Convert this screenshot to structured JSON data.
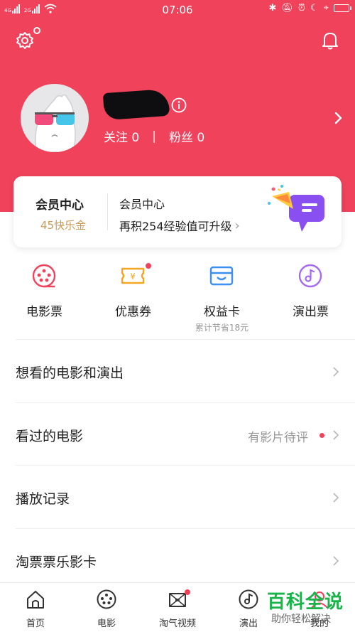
{
  "status_bar": {
    "signal_1": "4G",
    "signal_2": "2G",
    "time": "07:06"
  },
  "header": {
    "settings_icon": "gear-icon",
    "bell_icon": "bell-icon",
    "follow_label": "关注",
    "follow_count": "0",
    "separator": "|",
    "fans_label": "粉丝",
    "fans_count": "0",
    "brand_color": "#f1425c"
  },
  "member_card": {
    "title": "会员中心",
    "points": "45快乐金",
    "sub_title": "会员中心",
    "upgrade_text": "再积254经验值可升级",
    "arrow": "›"
  },
  "quick_links": [
    {
      "label": "电影票",
      "sub": "",
      "icon": "film-reel-icon"
    },
    {
      "label": "优惠券",
      "sub": "",
      "icon": "coupon-icon"
    },
    {
      "label": "权益卡",
      "sub": "累计节省18元",
      "icon": "card-icon"
    },
    {
      "label": "演出票",
      "sub": "",
      "icon": "music-note-icon"
    }
  ],
  "menu": [
    {
      "label": "想看的电影和演出",
      "value": ""
    },
    {
      "label": "看过的电影",
      "value": "有影片待评"
    },
    {
      "label": "播放记录",
      "value": ""
    },
    {
      "label": "淘票票乐影卡",
      "value": ""
    }
  ],
  "tab_bar": [
    {
      "label": "首页",
      "icon": "home-icon"
    },
    {
      "label": "电影",
      "icon": "film-reel-icon"
    },
    {
      "label": "淘气视频",
      "icon": "video-icon"
    },
    {
      "label": "演出",
      "icon": "music-note-icon"
    },
    {
      "label": "我的",
      "icon": "user-icon"
    }
  ],
  "watermark": {
    "main": "百科全说",
    "sub": "助你轻松解决"
  }
}
